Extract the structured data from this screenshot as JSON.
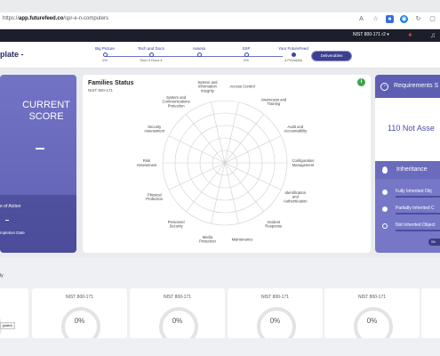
{
  "browser": {
    "url_prefix": "https://",
    "url_host": "app.futurefeed.co",
    "url_path": "/spr-e-n-computers"
  },
  "topbar": {
    "nist_select": "NIST 800-171 r2"
  },
  "header": {
    "title": "plate -",
    "steps": [
      {
        "label": "Big Picture",
        "value": "0%",
        "filled": true
      },
      {
        "label": "Tech and Docs",
        "value": "Tech 0  Docs 4",
        "filled": false
      },
      {
        "label": "Assess",
        "value": "",
        "filled": false
      },
      {
        "label": "SSP",
        "value": "0%",
        "filled": false
      },
      {
        "label": "Your FutureFeed",
        "value": "4 POA&Ms",
        "filled": false
      }
    ],
    "deliverables_label": "Deliverables"
  },
  "score": {
    "title": "CURRENT SCORE",
    "value": "-",
    "date_of_action_label": "e of Action",
    "date_of_action_value": "-",
    "completion_label": "mpletion Date"
  },
  "families": {
    "title": "Families Status",
    "subtitle": "NIST 800-171",
    "info_badge": "i",
    "labels": [
      "Access Control",
      "Awareness and Training",
      "Audit and Accountability",
      "Configuration Management",
      "Identification and Authentication",
      "Incident Response",
      "Maintenance",
      "Media Protection",
      "Personnel Security",
      "Physical Protection",
      "Risk Assessment",
      "Security Assessment",
      "System and Communications Protection",
      "System and Information Integrity"
    ],
    "values": [
      0,
      0,
      0,
      0,
      0,
      0,
      0,
      0,
      0,
      0,
      0,
      0,
      0,
      0
    ]
  },
  "requirements": {
    "title": "Requirements S",
    "count_text": "110  Not Asse",
    "inheritance_title": "Inheritance",
    "rows": [
      {
        "label": "Fully Inherited Obj",
        "selected": true
      },
      {
        "label": "Partially Inherited C",
        "selected": true
      },
      {
        "label": "Not Inherited Object",
        "selected": false
      }
    ],
    "button_label": "Sh"
  },
  "bottom": {
    "title": "ly",
    "cards": [
      {
        "label": "",
        "value": ""
      },
      {
        "label": "NIST 800-171",
        "value": "0%"
      },
      {
        "label": "NIST 800-171",
        "value": "0%"
      },
      {
        "label": "NIST 800-171",
        "value": "0%"
      },
      {
        "label": "NIST 800-171",
        "value": "0%"
      }
    ],
    "tooltip": "puters"
  }
}
